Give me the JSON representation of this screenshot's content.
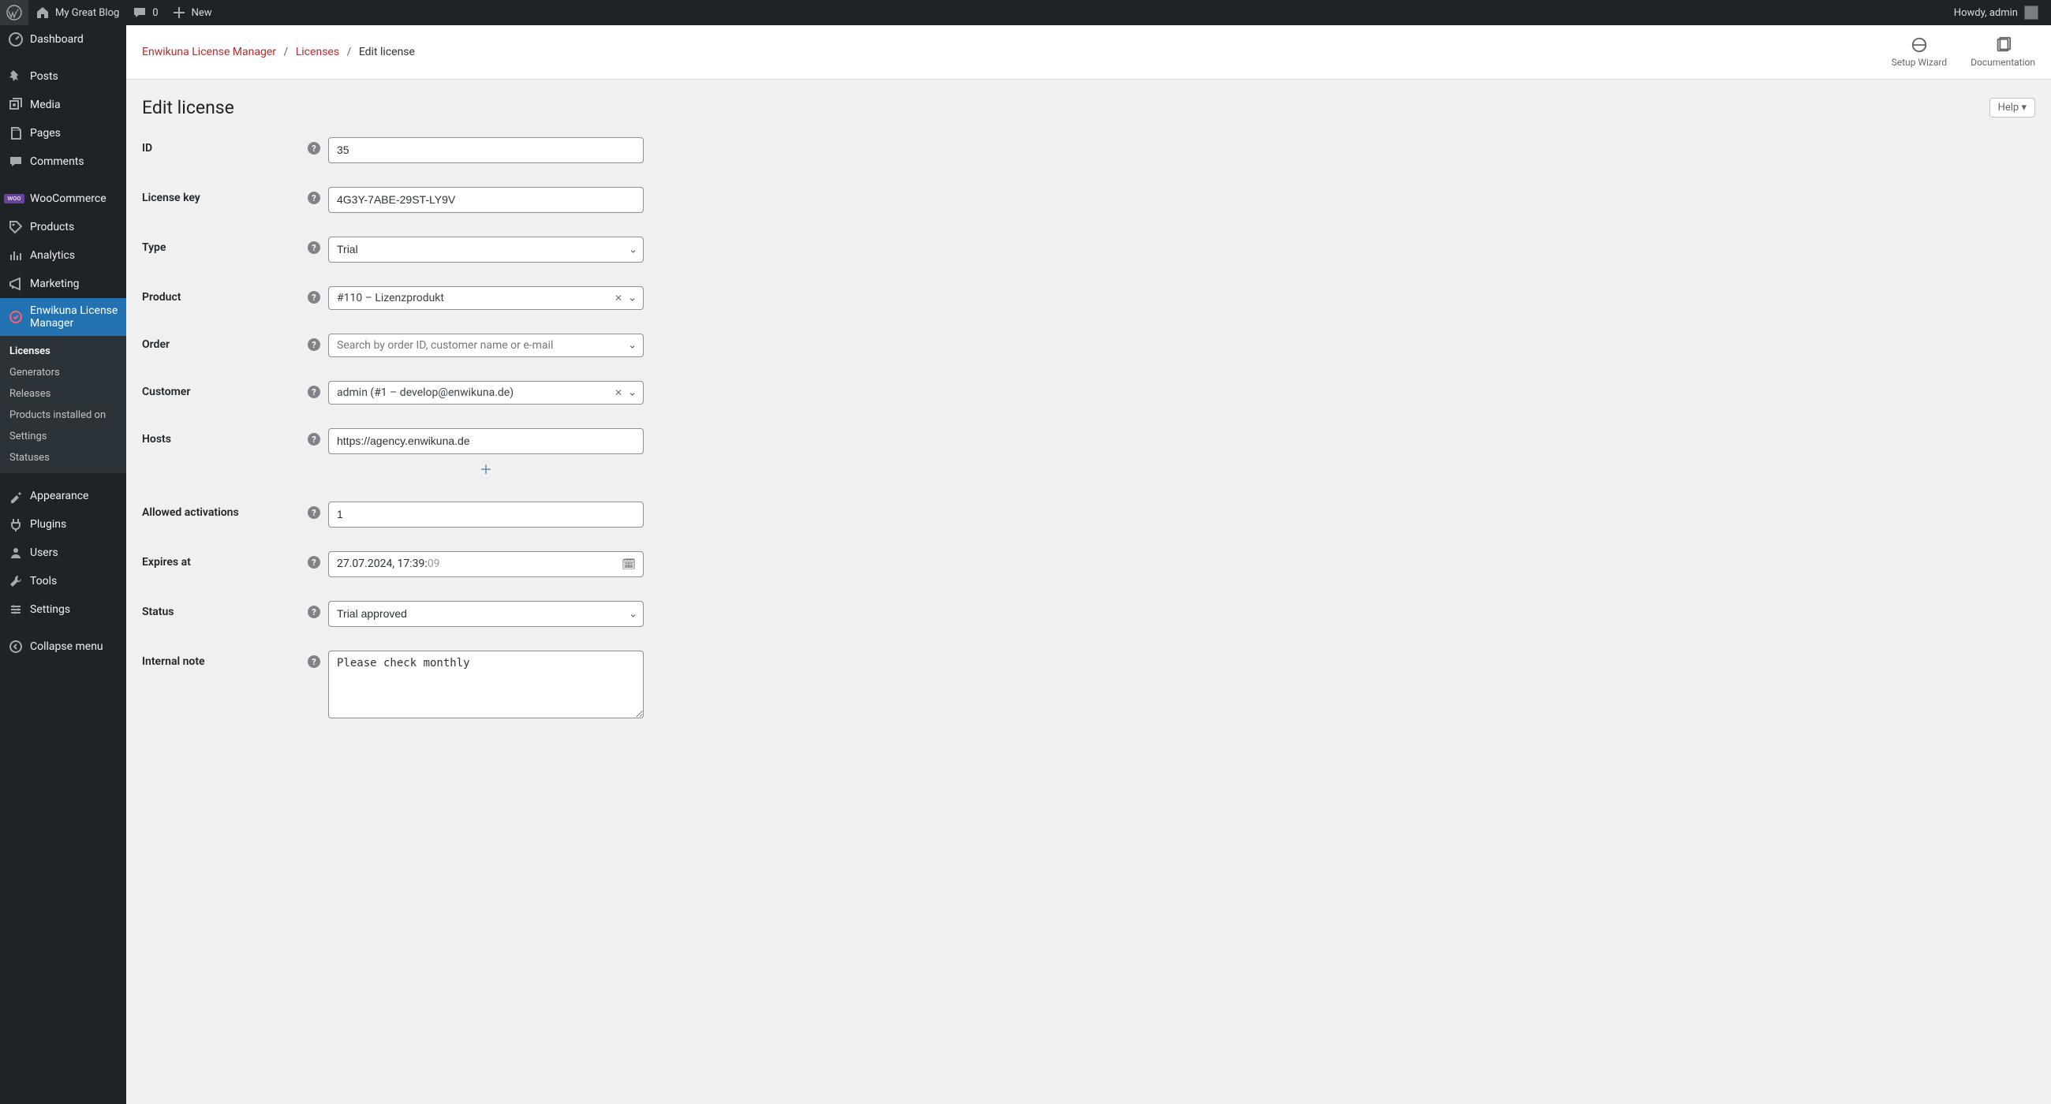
{
  "adminbar": {
    "site_name": "My Great Blog",
    "comments_count": "0",
    "new_label": "New",
    "howdy_prefix": "Howdy, ",
    "howdy_user": "admin"
  },
  "sidebar": {
    "items": [
      {
        "label": "Dashboard"
      },
      {
        "label": "Posts"
      },
      {
        "label": "Media"
      },
      {
        "label": "Pages"
      },
      {
        "label": "Comments"
      },
      {
        "label": "WooCommerce"
      },
      {
        "label": "Products"
      },
      {
        "label": "Analytics"
      },
      {
        "label": "Marketing"
      },
      {
        "label": "Enwikuna License Manager"
      },
      {
        "label": "Appearance"
      },
      {
        "label": "Plugins"
      },
      {
        "label": "Users"
      },
      {
        "label": "Tools"
      },
      {
        "label": "Settings"
      },
      {
        "label": "Collapse menu"
      }
    ],
    "submenu": {
      "items": [
        {
          "label": "Licenses",
          "current": true
        },
        {
          "label": "Generators"
        },
        {
          "label": "Releases"
        },
        {
          "label": "Products installed on"
        },
        {
          "label": "Settings"
        },
        {
          "label": "Statuses"
        }
      ]
    }
  },
  "header_actions": {
    "setup_wizard": "Setup Wizard",
    "documentation": "Documentation"
  },
  "breadcrumb": {
    "a": "Enwikuna License Manager",
    "b": "Licenses",
    "c": "Edit license",
    "sep": "/"
  },
  "page": {
    "title": "Edit license",
    "help": "Help"
  },
  "form": {
    "labels": {
      "id": "ID",
      "license_key": "License key",
      "type": "Type",
      "product": "Product",
      "order": "Order",
      "customer": "Customer",
      "hosts": "Hosts",
      "allowed_activations": "Allowed activations",
      "expires_at": "Expires at",
      "status": "Status",
      "internal_note": "Internal note"
    },
    "values": {
      "id": "35",
      "license_key": "4G3Y-7ABE-29ST-LY9V",
      "type": "Trial",
      "product": "#110 – Lizenzprodukt",
      "order_placeholder": "Search by order ID, customer name or e-mail",
      "customer": "admin (#1 – develop@enwikuna.de)",
      "hosts": [
        "https://agency.enwikuna.de"
      ],
      "allowed_activations": "1",
      "expires_at_main": "27.07.2024, 17:39:",
      "expires_at_sec": "09",
      "status": "Trial approved",
      "internal_note": "Please check monthly"
    }
  }
}
